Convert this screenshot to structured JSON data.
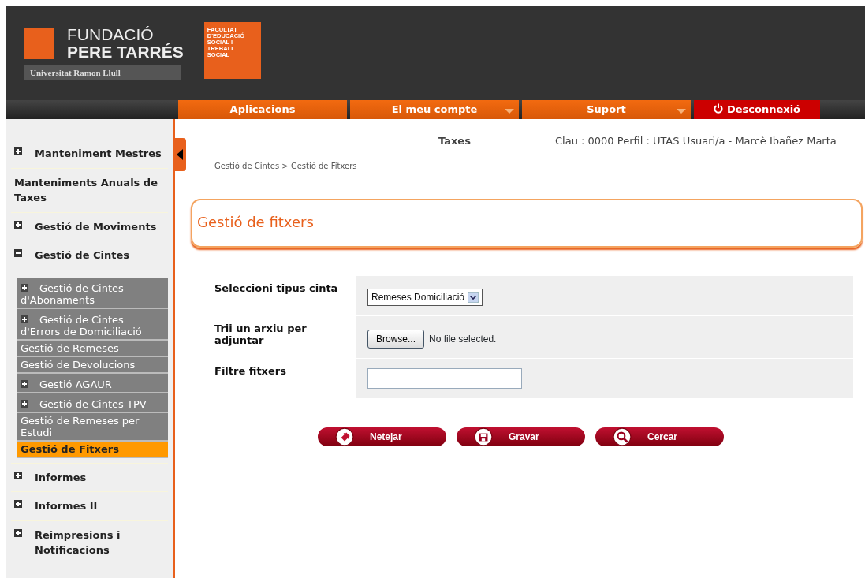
{
  "header": {
    "logo_line_1": "FUNDACIÓ",
    "logo_line_2": "PERE TARRÉS",
    "logo_subtitle": "Universitat Ramon Llull",
    "faculty_logo": [
      "FACULTAT",
      "D'EDUCACIÓ",
      "SOCIAL I",
      "TREBALL",
      "SOCIAL"
    ]
  },
  "nav": [
    {
      "label": "Aplicacions",
      "kind": "menu"
    },
    {
      "label": "El meu compte",
      "kind": "dropdown"
    },
    {
      "label": "Suport",
      "kind": "dropdown"
    },
    {
      "label": "Desconnexió",
      "kind": "logout"
    }
  ],
  "sidebar": {
    "items": [
      {
        "label": "Manteniment Mestres",
        "kind": "group",
        "expanded": false
      },
      {
        "label": "Manteniments Anuals de Taxes",
        "kind": "link"
      },
      {
        "label": "Gestió de Moviments",
        "kind": "group",
        "expanded": false
      },
      {
        "label": "Gestió de Cintes",
        "kind": "group",
        "expanded": true,
        "children": [
          {
            "label": "Gestió de Cintes d'Abonaments",
            "kind": "group",
            "selected": false
          },
          {
            "label": "Gestió de Cintes d'Errors de Domiciliació",
            "kind": "group",
            "selected": false
          },
          {
            "label": "Gestió de Remeses",
            "kind": "link",
            "selected": false
          },
          {
            "label": "Gestió de Devolucions",
            "kind": "link",
            "selected": false
          },
          {
            "label": "Gestió AGAUR",
            "kind": "group",
            "selected": false
          },
          {
            "label": "Gestió de Cintes TPV",
            "kind": "group",
            "selected": false
          },
          {
            "label": "Gestió de Remeses per Estudi",
            "kind": "link",
            "selected": false
          },
          {
            "label": "Gestió de Fitxers",
            "kind": "link",
            "selected": true
          }
        ]
      },
      {
        "label": "Informes",
        "kind": "group",
        "expanded": false
      },
      {
        "label": "Informes II",
        "kind": "group",
        "expanded": false
      },
      {
        "label": "Reimpresions i Notificacions",
        "kind": "group",
        "expanded": false
      }
    ]
  },
  "info": {
    "title": "Taxes",
    "user": "Clau : 0000  Perfil : UTAS  Usuari/a - Marcè Ibañez Marta"
  },
  "breadcrumb": "Gestió de Cintes > Gestió de Fitxers",
  "panel_title": "Gestió de fitxers",
  "form": [
    {
      "label": "Seleccioni tipus cinta",
      "kind": "select",
      "value": "Remeses Domiciliació"
    },
    {
      "label": "Trii un arxiu per adjuntar",
      "kind": "file",
      "button": "Browse...",
      "status": "No file selected."
    },
    {
      "label": "Filtre fitxers",
      "kind": "text"
    }
  ],
  "buttons": [
    {
      "label": "Netejar"
    },
    {
      "label": "Gravar"
    },
    {
      "label": "Cercar"
    }
  ]
}
